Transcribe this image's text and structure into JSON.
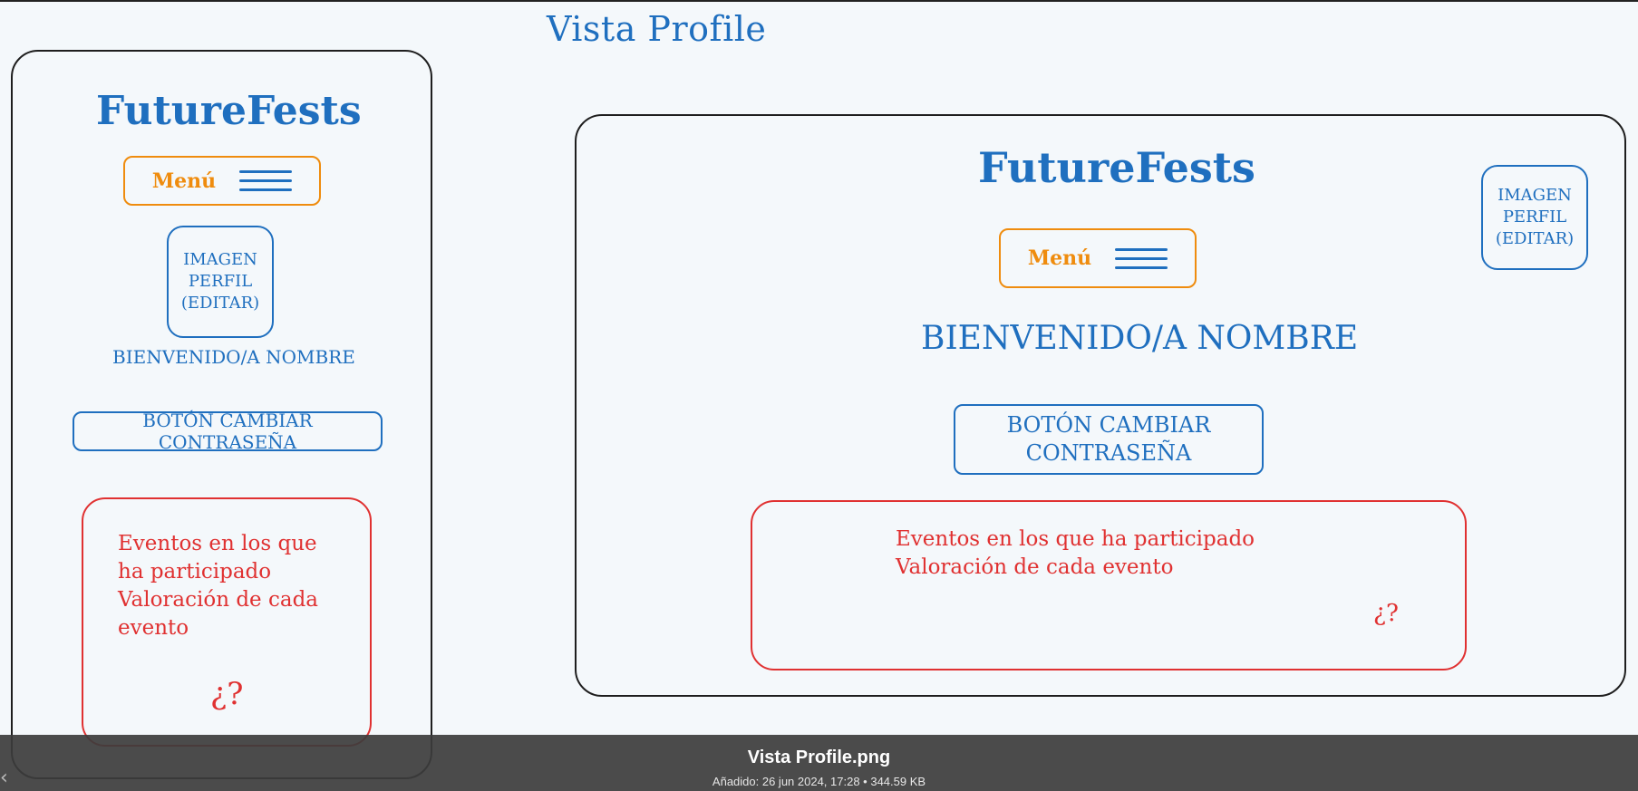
{
  "canvas": {
    "title": "Vista Profile"
  },
  "mobile_view": {
    "brand": "FutureFests",
    "menu_label": "Menú",
    "avatar_text": "IMAGEN\nPERFIL\n(EDITAR)",
    "welcome": "BIENVENIDO/A NOMBRE",
    "change_password": "BOTÓN CAMBIAR CONTRASEÑA",
    "events_text": "Eventos en los que\nha participado\nValoración de cada\nevento",
    "events_question": "¿?"
  },
  "desktop_view": {
    "brand": "FutureFests",
    "menu_label": "Menú",
    "avatar_text": "IMAGEN\nPERFIL\n(EDITAR)",
    "welcome": "BIENVENIDO/A NOMBRE",
    "change_password": "BOTÓN CAMBIAR\nCONTRASEÑA",
    "events_text": "Eventos en los que ha participado\nValoración de cada evento",
    "events_question": "¿?"
  },
  "viewer": {
    "file_name": "Vista Profile.png",
    "meta": "Añadido: 26 jun 2024, 17:28 • 344.59 KB",
    "prev_icon": "chevron-left-icon"
  },
  "colors": {
    "blue": "#1f6fbf",
    "orange": "#ef8c0e",
    "red": "#e03131",
    "ink": "#1e1e1e"
  }
}
